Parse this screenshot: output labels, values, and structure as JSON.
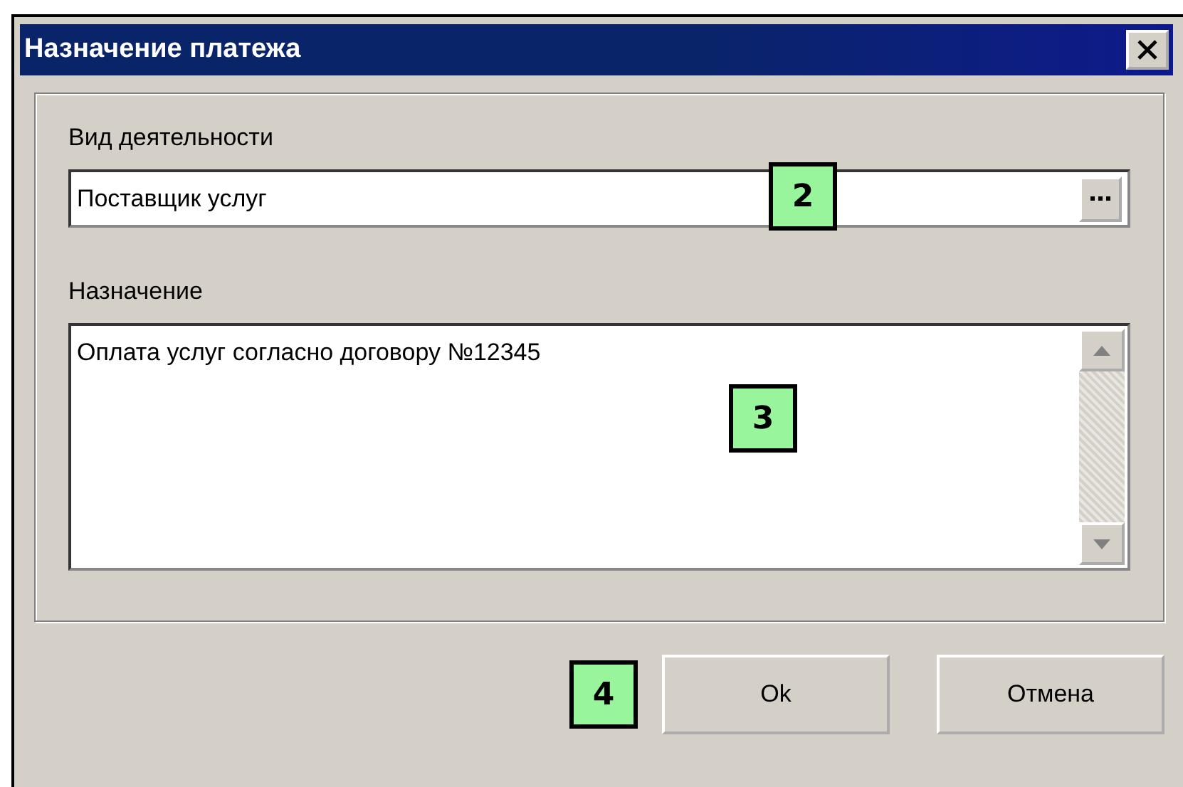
{
  "window": {
    "title": "Назначение платежа"
  },
  "activity": {
    "label": "Вид деятельности",
    "value": "Поставщик услуг",
    "callout": "2"
  },
  "purpose": {
    "label": "Назначение",
    "value": "Оплата услуг согласно договору №12345",
    "callout": "3"
  },
  "footer": {
    "callout": "4",
    "buttons": [
      "Ok",
      "Отмена"
    ]
  }
}
